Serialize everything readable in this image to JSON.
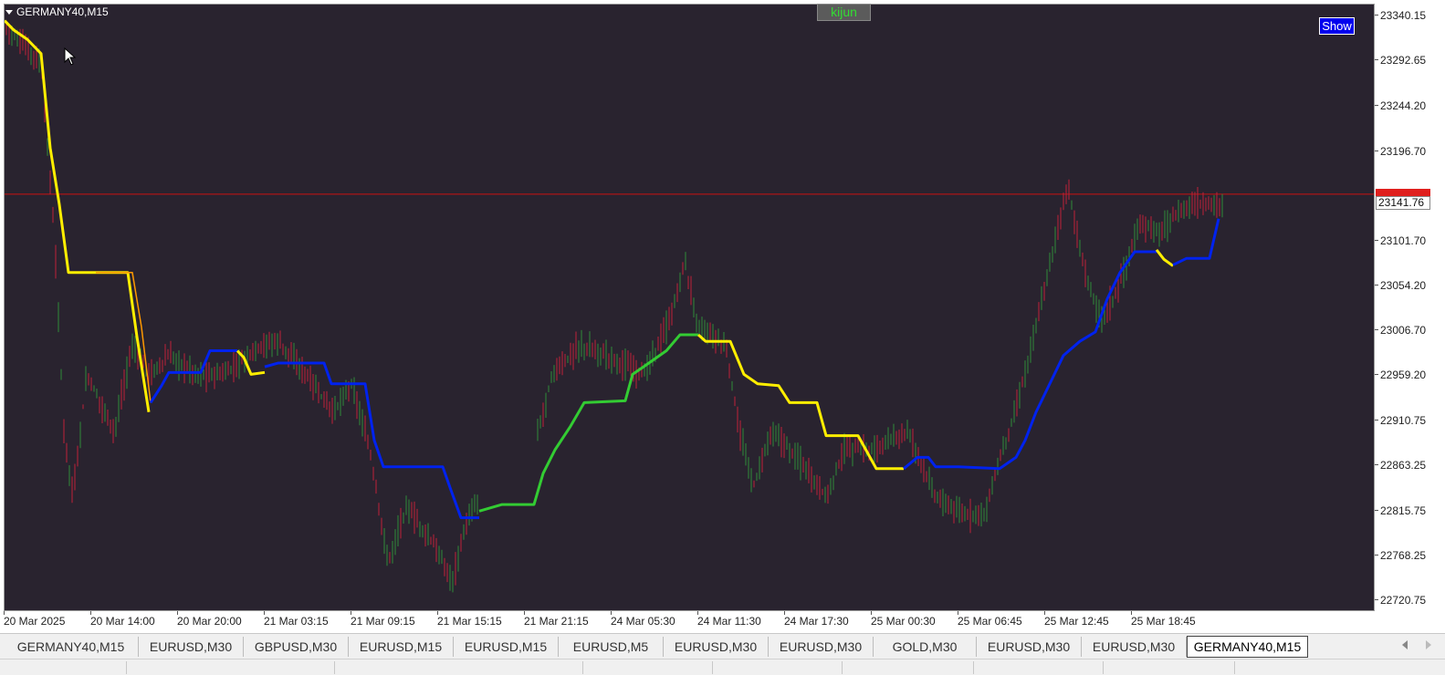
{
  "chart": {
    "symbol_label": "GERMANY40,M15",
    "indicator_label": "kijun",
    "show_button_label": "Show",
    "current_price": "23141.76",
    "colors": {
      "background": "#29232f",
      "bull_candle": "#2e8b3a",
      "bear_candle": "#c0203a",
      "kijun_fast": "#ffee00",
      "kijun_slow": "#ff9900",
      "kijun_up": "#0022ee",
      "kijun_up2": "#33cc33",
      "price_line": "#cc1111"
    }
  },
  "price_axis": {
    "ticks": [
      "23340.15",
      "23292.65",
      "23244.20",
      "23196.70",
      "23101.70",
      "23054.20",
      "23006.70",
      "22959.20",
      "22910.75",
      "22863.25",
      "22815.75",
      "22768.25",
      "22720.75"
    ],
    "ticks_values": [
      23340.15,
      23292.65,
      23244.2,
      23196.7,
      23101.7,
      23054.2,
      23006.7,
      22959.2,
      22910.75,
      22863.25,
      22815.75,
      22768.25,
      22720.75
    ]
  },
  "time_axis": {
    "ticks": [
      "20 Mar 2025",
      "20 Mar 14:00",
      "20 Mar 20:00",
      "21 Mar 03:15",
      "21 Mar 09:15",
      "21 Mar 15:15",
      "21 Mar 21:15",
      "24 Mar 05:30",
      "24 Mar 11:30",
      "24 Mar 17:30",
      "25 Mar 00:30",
      "25 Mar 06:45",
      "25 Mar 12:45",
      "25 Mar 18:45"
    ]
  },
  "tabs": [
    {
      "label": "GERMANY40,M15",
      "active": false
    },
    {
      "label": "EURUSD,M30",
      "active": false
    },
    {
      "label": "GBPUSD,M30",
      "active": false
    },
    {
      "label": "EURUSD,M15",
      "active": false
    },
    {
      "label": "EURUSD,M15",
      "active": false
    },
    {
      "label": "EURUSD,M5",
      "active": false
    },
    {
      "label": "EURUSD,M30",
      "active": false
    },
    {
      "label": "EURUSD,M30",
      "active": false
    },
    {
      "label": "GOLD,M30",
      "active": false
    },
    {
      "label": "EURUSD,M30",
      "active": false
    },
    {
      "label": "EURUSD,M30",
      "active": false
    },
    {
      "label": "GERMANY40,M15",
      "active": true
    }
  ],
  "chart_data": {
    "type": "line",
    "ylim": [
      22708,
      23352
    ],
    "price_line": 23151,
    "series": [
      {
        "color": "#ffee00",
        "points": [
          [
            0,
            23335
          ],
          [
            10,
            23325
          ],
          [
            25,
            23315
          ],
          [
            40,
            23300
          ],
          [
            50,
            23200
          ],
          [
            60,
            23140
          ],
          [
            70,
            23068
          ],
          [
            100,
            23068
          ],
          [
            135,
            23068
          ],
          [
            145,
            23000
          ],
          [
            158,
            22920
          ]
        ]
      },
      {
        "color": "#ff9900",
        "points": [
          [
            100,
            23068
          ],
          [
            140,
            23068
          ],
          [
            150,
            23010
          ],
          [
            160,
            22930
          ]
        ]
      },
      {
        "color": "#0022ee",
        "points": [
          [
            160,
            22930
          ],
          [
            172,
            22948
          ],
          [
            180,
            22962
          ],
          [
            215,
            22962
          ],
          [
            225,
            22985
          ],
          [
            255,
            22985
          ]
        ]
      },
      {
        "color": "#ffee00",
        "points": [
          [
            255,
            22985
          ],
          [
            262,
            22978
          ],
          [
            270,
            22960
          ],
          [
            285,
            22962
          ]
        ]
      },
      {
        "color": "#0022ee",
        "points": [
          [
            285,
            22968
          ],
          [
            300,
            22972
          ],
          [
            350,
            22972
          ],
          [
            358,
            22950
          ],
          [
            395,
            22950
          ],
          [
            405,
            22890
          ],
          [
            415,
            22862
          ],
          [
            480,
            22862
          ],
          [
            488,
            22840
          ],
          [
            500,
            22808
          ],
          [
            520,
            22808
          ]
        ]
      },
      {
        "color": "#33cc33",
        "points": [
          [
            520,
            22815
          ],
          [
            545,
            22822
          ],
          [
            580,
            22822
          ],
          [
            590,
            22855
          ],
          [
            603,
            22880
          ],
          [
            620,
            22905
          ],
          [
            635,
            22930
          ],
          [
            680,
            22932
          ],
          [
            688,
            22960
          ],
          [
            700,
            22968
          ],
          [
            725,
            22985
          ],
          [
            740,
            23002
          ],
          [
            760,
            23002
          ]
        ]
      },
      {
        "color": "#ffee00",
        "points": [
          [
            760,
            23002
          ],
          [
            768,
            22995
          ],
          [
            795,
            22995
          ],
          [
            810,
            22960
          ],
          [
            825,
            22950
          ],
          [
            848,
            22948
          ],
          [
            860,
            22930
          ],
          [
            890,
            22930
          ],
          [
            900,
            22895
          ],
          [
            935,
            22895
          ],
          [
            955,
            22860
          ],
          [
            985,
            22860
          ]
        ]
      },
      {
        "color": "#0022ee",
        "points": [
          [
            985,
            22860
          ],
          [
            1000,
            22872
          ],
          [
            1012,
            22872
          ],
          [
            1020,
            22862
          ],
          [
            1045,
            22862
          ],
          [
            1090,
            22860
          ],
          [
            1108,
            22872
          ],
          [
            1118,
            22890
          ],
          [
            1130,
            22920
          ],
          [
            1145,
            22950
          ],
          [
            1160,
            22980
          ],
          [
            1178,
            22995
          ],
          [
            1195,
            23005
          ],
          [
            1208,
            23040
          ],
          [
            1222,
            23068
          ],
          [
            1238,
            23090
          ],
          [
            1262,
            23090
          ]
        ]
      },
      {
        "color": "#ffee00",
        "points": [
          [
            1262,
            23092
          ],
          [
            1270,
            23082
          ],
          [
            1280,
            23075
          ]
        ]
      },
      {
        "color": "#0022ee",
        "points": [
          [
            1280,
            23076
          ],
          [
            1295,
            23083
          ],
          [
            1320,
            23083
          ],
          [
            1330,
            23125
          ]
        ]
      }
    ]
  }
}
